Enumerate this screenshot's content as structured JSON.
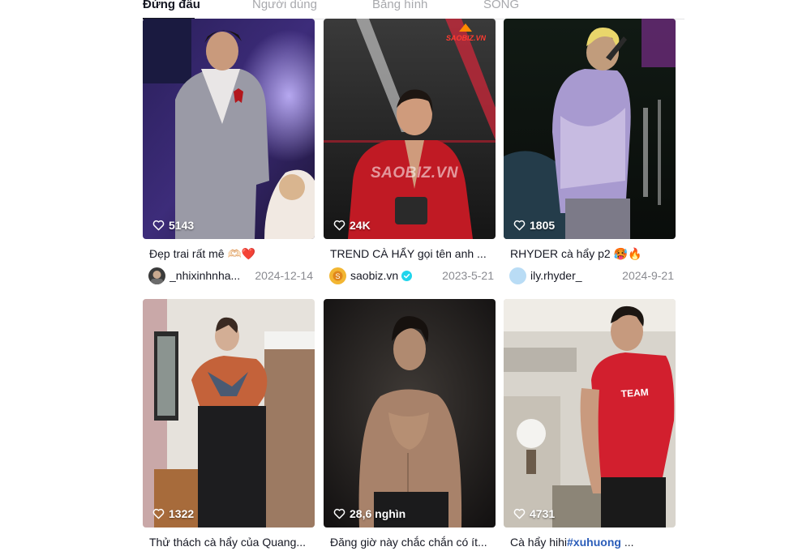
{
  "tabs": [
    {
      "label": "Đứng đầu",
      "active": true
    },
    {
      "label": "Người dùng",
      "active": false
    },
    {
      "label": "Băng hình",
      "active": false
    },
    {
      "label": "SONG",
      "active": false
    }
  ],
  "videos": [
    {
      "likes": "5143",
      "caption": "Đẹp trai rất mê 🫶🏻❤️",
      "username": "_nhixinhnha...",
      "verified": false,
      "date": "2024-12-14",
      "avatar_color": "#3b3b3b"
    },
    {
      "likes": "24K",
      "caption": "TREND CÀ HẨY gọi tên anh ...",
      "username": "saobiz.vn",
      "verified": true,
      "date": "2023-5-21",
      "avatar_color": "#f2b632",
      "watermark": "SAOBIZ.VN",
      "brand_mark": "SAOBIZ.VN"
    },
    {
      "likes": "1805",
      "caption": "RHYDER cà hẩy p2 🥵🔥",
      "username": "ily.rhyder_",
      "verified": false,
      "date": "2024-9-21",
      "avatar_color": "#b9dcf5"
    },
    {
      "likes": "1322",
      "caption": "Thử thách cà hẩy của Quang...",
      "username": "",
      "verified": false,
      "date": ""
    },
    {
      "likes": "28,6 nghìn",
      "caption": "Đăng giờ này chắc chắn có ít...",
      "username": "",
      "verified": false,
      "date": ""
    },
    {
      "likes": "4731",
      "caption_prefix": "Cà hẩy hihi",
      "caption_hashtag": "#xuhuong",
      "caption_suffix": " ...",
      "username": "",
      "verified": false,
      "date": ""
    }
  ],
  "icons": {
    "like": "heart-outline-icon",
    "verified": "verified-badge-icon"
  },
  "colors": {
    "accent_hashtag": "#2b5db9",
    "verified": "#20d5ec",
    "text_muted": "#8a8b91"
  }
}
